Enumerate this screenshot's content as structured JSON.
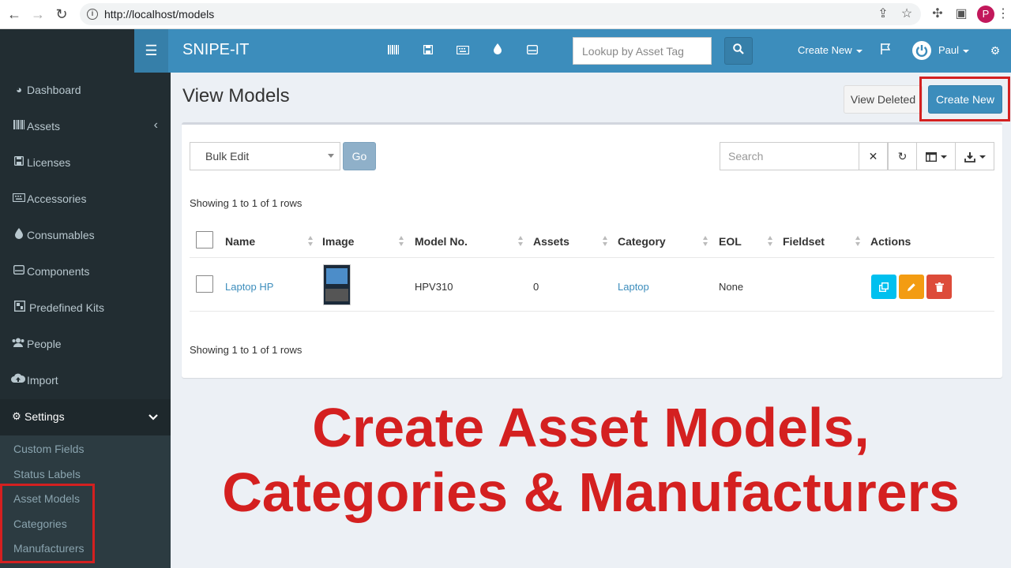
{
  "browser": {
    "url": "http://localhost/models",
    "profile_initial": "P",
    "icons": [
      "back-icon",
      "forward-icon",
      "reload-icon",
      "info-icon",
      "share-icon",
      "star-icon",
      "extensions-icon",
      "sidepanel-icon",
      "menu-icon"
    ]
  },
  "header": {
    "brand": "SNIPE-IT",
    "toggle_icon": "hamburger-icon",
    "nav_icons": [
      "barcode-icon",
      "save-icon",
      "keyboard-icon",
      "tint-icon",
      "hdd-icon"
    ],
    "lookup_placeholder": "Lookup by Asset Tag",
    "create_new": "Create New",
    "user_name": "Paul",
    "accent_color": "#3c8dbc"
  },
  "sidebar": {
    "items": [
      {
        "label": "Dashboard",
        "icon": "dashboard-icon"
      },
      {
        "label": "Assets",
        "icon": "barcode-icon"
      },
      {
        "label": "Licenses",
        "icon": "save-icon"
      },
      {
        "label": "Accessories",
        "icon": "keyboard-icon"
      },
      {
        "label": "Consumables",
        "icon": "tint-icon"
      },
      {
        "label": "Components",
        "icon": "hdd-icon"
      },
      {
        "label": "Predefined Kits",
        "icon": "kits-icon"
      },
      {
        "label": "People",
        "icon": "users-icon"
      },
      {
        "label": "Import",
        "icon": "cloud-upload-icon"
      },
      {
        "label": "Settings",
        "icon": "gear-icon"
      }
    ],
    "settings_sub": [
      "Custom Fields",
      "Status Labels",
      "Asset Models",
      "Categories",
      "Manufacturers"
    ]
  },
  "page": {
    "title": "View Models",
    "view_deleted": "View Deleted",
    "create_new": "Create New"
  },
  "toolbar": {
    "bulk_select": "Bulk Edit",
    "go": "Go",
    "search_placeholder": "Search",
    "clear": "✕"
  },
  "table": {
    "showing_top": "Showing 1 to 1 of 1 rows",
    "showing_bottom": "Showing 1 to 1 of 1 rows",
    "columns": [
      "Name",
      "Image",
      "Model No.",
      "Assets",
      "Category",
      "EOL",
      "Fieldset",
      "Actions"
    ],
    "rows": [
      {
        "name": "Laptop HP",
        "model_no": "HPV310",
        "assets": "0",
        "category": "Laptop",
        "eol": "None",
        "fieldset": ""
      }
    ]
  },
  "overlay": {
    "line1": "Create Asset Models,",
    "line2": "Categories & Manufacturers",
    "color": "#d42020"
  }
}
